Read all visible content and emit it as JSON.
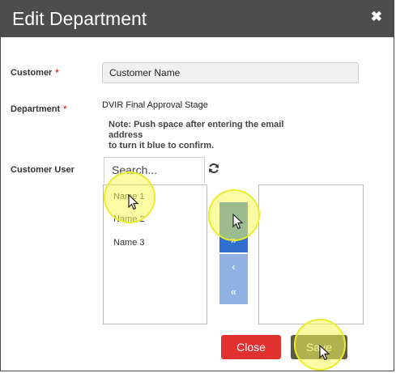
{
  "dialog": {
    "title": "Edit Department",
    "close_glyph": "✖"
  },
  "form": {
    "customer_label": "Customer",
    "customer_value": "Customer Name",
    "department_label": "Department",
    "department_value": "DVIR Final Approval Stage",
    "required_mark": "*",
    "note_line1": "Note: Push space after entering the email address",
    "note_line2": "to turn it blue to confirm.",
    "customer_user_label": "Customer User",
    "search_placeholder": "Search..."
  },
  "available_users": [
    "Name 1",
    "Name 2",
    "Name 3"
  ],
  "selected_users": [],
  "transfer_buttons": {
    "move_one_right": "›",
    "move_all_right": "»",
    "move_one_left": "‹",
    "move_all_left": "«"
  },
  "footer": {
    "close_label": "Close",
    "save_label": "Save"
  },
  "icons": {
    "refresh": "refresh-icon",
    "close": "close-icon",
    "cursor": "mouse-pointer-icon"
  },
  "colors": {
    "header_bg": "#4d4d4d",
    "required": "#d9352b",
    "close_button": "#e0302f",
    "save_button": "#5c5c46",
    "transfer_active": "#2f6fd0",
    "transfer_inactive": "#8fb2e2",
    "highlight": "#f6fa5a"
  }
}
